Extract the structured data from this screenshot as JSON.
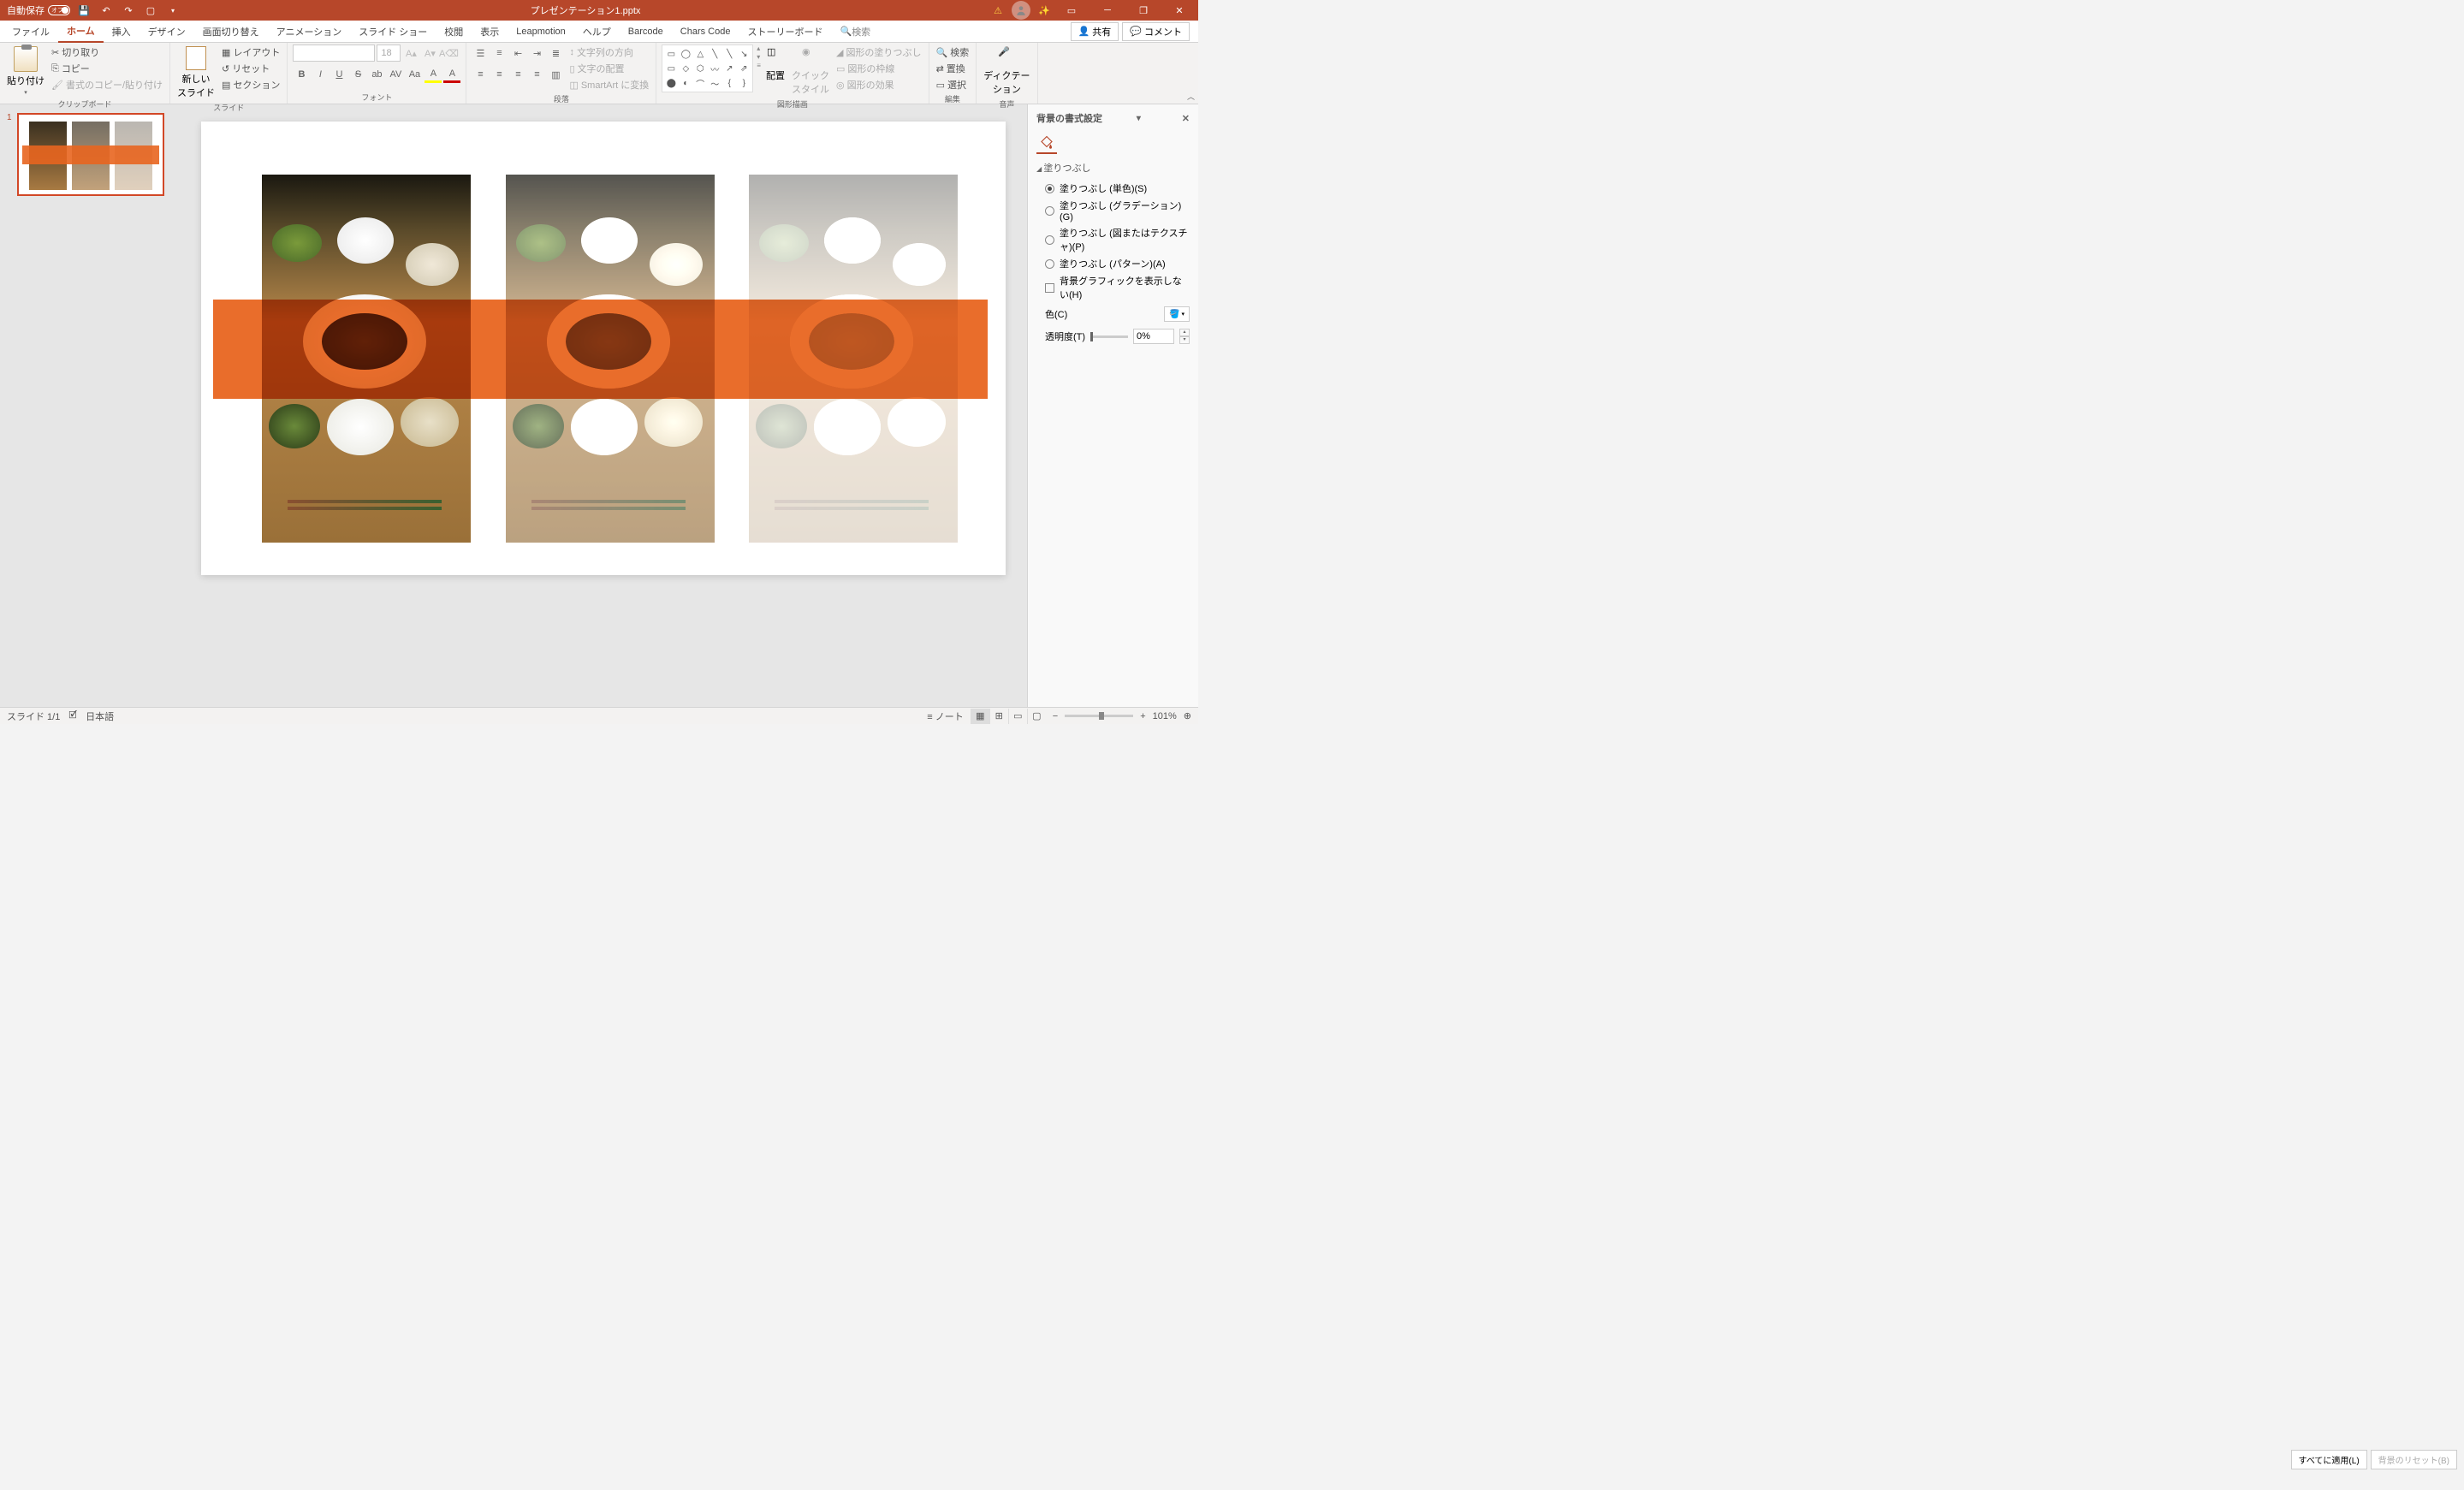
{
  "titlebar": {
    "autosave_label": "自動保存",
    "autosave_state": "オフ",
    "filename": "プレゼンテーション1.pptx"
  },
  "tabs": {
    "file": "ファイル",
    "home": "ホーム",
    "insert": "挿入",
    "design": "デザイン",
    "transitions": "画面切り替え",
    "animations": "アニメーション",
    "slideshow": "スライド ショー",
    "review": "校閲",
    "view": "表示",
    "leapmotion": "Leapmotion",
    "help": "ヘルプ",
    "barcode": "Barcode",
    "charscode": "Chars Code",
    "storyboard": "ストーリーボード",
    "search": "検索",
    "share": "共有",
    "comment": "コメント"
  },
  "ribbon": {
    "clipboard": {
      "paste": "貼り付け",
      "cut": "切り取り",
      "copy": "コピー",
      "format_painter": "書式のコピー/貼り付け",
      "group": "クリップボード"
    },
    "slides": {
      "new_slide": "新しい\nスライド",
      "layout": "レイアウト",
      "reset": "リセット",
      "section": "セクション",
      "group": "スライド"
    },
    "font": {
      "size": "18",
      "group": "フォント"
    },
    "paragraph": {
      "text_direction": "文字列の方向",
      "text_align": "文字の配置",
      "smartart": "SmartArt に変換",
      "group": "段落"
    },
    "drawing": {
      "arrange": "配置",
      "quick_styles": "クイック\nスタイル",
      "shape_fill": "図形の塗りつぶし",
      "shape_outline": "図形の枠線",
      "shape_effects": "図形の効果",
      "group": "図形描画"
    },
    "editing": {
      "find": "検索",
      "replace": "置換",
      "select": "選択",
      "group": "編集"
    },
    "voice": {
      "dictate": "ディクテー\nション",
      "group": "音声"
    }
  },
  "thumbs": {
    "slide1_num": "1"
  },
  "pane": {
    "title": "背景の書式設定",
    "section_fill": "塗りつぶし",
    "fill_solid": "塗りつぶし (単色)(S)",
    "fill_gradient": "塗りつぶし (グラデーション)(G)",
    "fill_picture": "塗りつぶし (図またはテクスチャ)(P)",
    "fill_pattern": "塗りつぶし (パターン)(A)",
    "hide_bg": "背景グラフィックを表示しない(H)",
    "color": "色(C)",
    "transparency": "透明度(T)",
    "transparency_val": "0%",
    "apply_all": "すべてに適用(L)",
    "reset_bg": "背景のリセット(B)"
  },
  "statusbar": {
    "slide": "スライド 1/1",
    "lang": "日本語",
    "notes": "ノート",
    "zoom": "101%"
  }
}
